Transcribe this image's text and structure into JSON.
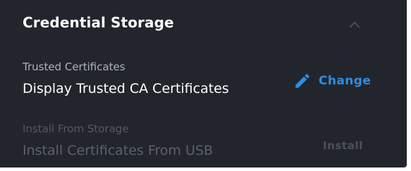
{
  "section": {
    "title": "Credential Storage",
    "collapse_icon": "chevron-up-icon"
  },
  "settings": [
    {
      "label": "Trusted Certificates",
      "value": "Display Trusted CA Certificates",
      "action_label": "Change",
      "action_icon": "pencil-icon",
      "enabled": true
    },
    {
      "label": "Install From Storage",
      "value": "Install Certificates From USB",
      "action_label": "Install",
      "enabled": false
    }
  ],
  "colors": {
    "panel_background": "#22252c",
    "accent": "#2f8ee3",
    "disabled_text": "#5c616a"
  }
}
